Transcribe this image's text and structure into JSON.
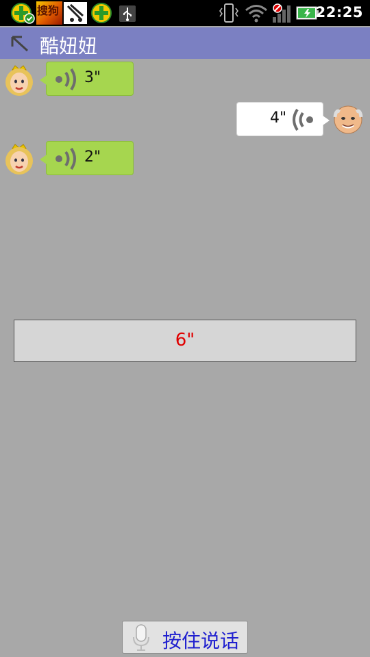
{
  "status_bar": {
    "time": "22:25",
    "icons": [
      "app-plus-check-icon",
      "sogou-search-app-icon",
      "media-app-icon",
      "app-plus-icon",
      "usb-icon",
      "vibrate-icon",
      "wifi-icon",
      "signal-icon",
      "battery-charging-icon"
    ],
    "notification_text": "搜狗"
  },
  "header": {
    "title": "酷妞妞",
    "back_icon": "back-arrow-icon"
  },
  "messages": [
    {
      "side": "left",
      "avatar": "princess-avatar",
      "duration": "3\"",
      "bubble_color": "#a6d64f"
    },
    {
      "side": "right",
      "avatar": "old-man-avatar",
      "duration": "4\"",
      "bubble_color": "#ffffff"
    },
    {
      "side": "left",
      "avatar": "princess-avatar",
      "duration": "2\"",
      "bubble_color": "#a6d64f"
    }
  ],
  "recording": {
    "duration": "6\"",
    "text_color": "#e00000"
  },
  "footer": {
    "talk_button_label": "按住说话",
    "mic_icon": "microphone-icon"
  },
  "colors": {
    "header": "#7b80c2",
    "background": "#a8a8a8",
    "status_bar": "#000000"
  }
}
